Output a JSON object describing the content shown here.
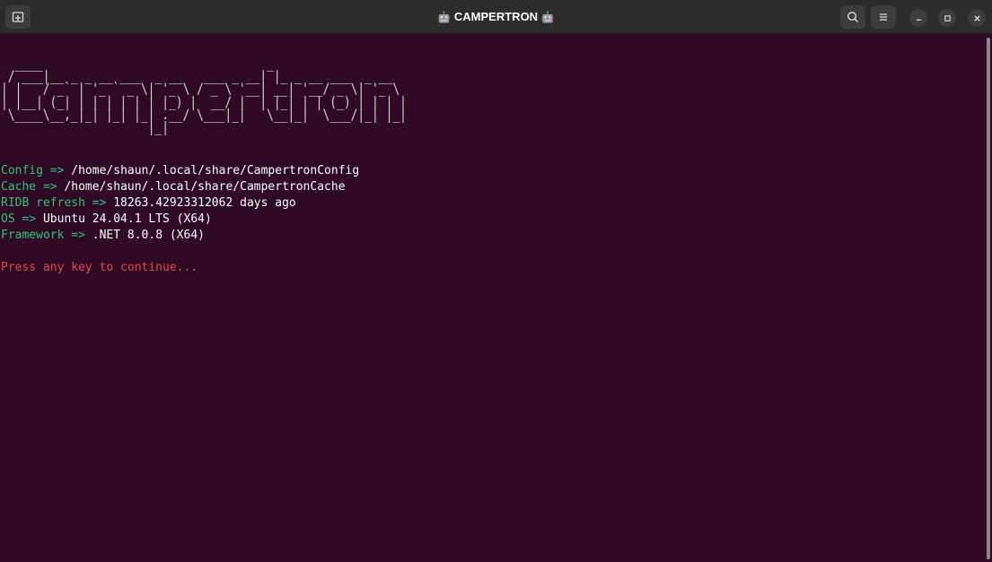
{
  "window": {
    "title": "CAMPERTRON",
    "title_emoji": "🤖",
    "icons": {
      "new_tab": "new-tab-icon",
      "search": "search-icon",
      "menu": "hamburger-menu-icon",
      "minimize": "minimize-icon",
      "maximize": "maximize-icon",
      "close": "close-icon"
    }
  },
  "terminal": {
    "banner_text": "Campertron",
    "ascii_art": "  ____                                _                   \n / ___|__ _ _ __ ___  _ __   ___ _ __| |_ _ __ ___  _ __  \n| |   / _` | '_ ` _ \\| '_ \\ / _ \\ '__| __| '__/ _ \\| '_ \\ \n| |__| (_| | | | | | | |_) |  __/ |  | |_| | | (_) | | | |\n \\____\\__,_|_| |_| |_| .__/ \\___|_|   \\__|_|  \\___/|_| |_|\n                     |_|                                  ",
    "info": [
      {
        "key": "Config =>",
        "value": " /home/shaun/.local/share/CampertronConfig"
      },
      {
        "key": "Cache =>",
        "value": " /home/shaun/.local/share/CampertronCache"
      },
      {
        "key": "RIDB refresh =>",
        "value": " 18263.42923312062 days ago"
      },
      {
        "key": "OS =>",
        "value": " Ubuntu 24.04.1 LTS (X64)"
      },
      {
        "key": "Framework =>",
        "value": " .NET 8.0.8 (X64)"
      }
    ],
    "prompt": "Press any key to continue...",
    "colors": {
      "background": "#300a24",
      "key": "#2ec27e",
      "value": "#ffffff",
      "prompt": "#e5474c",
      "ascii": "#c6e0c6"
    }
  }
}
